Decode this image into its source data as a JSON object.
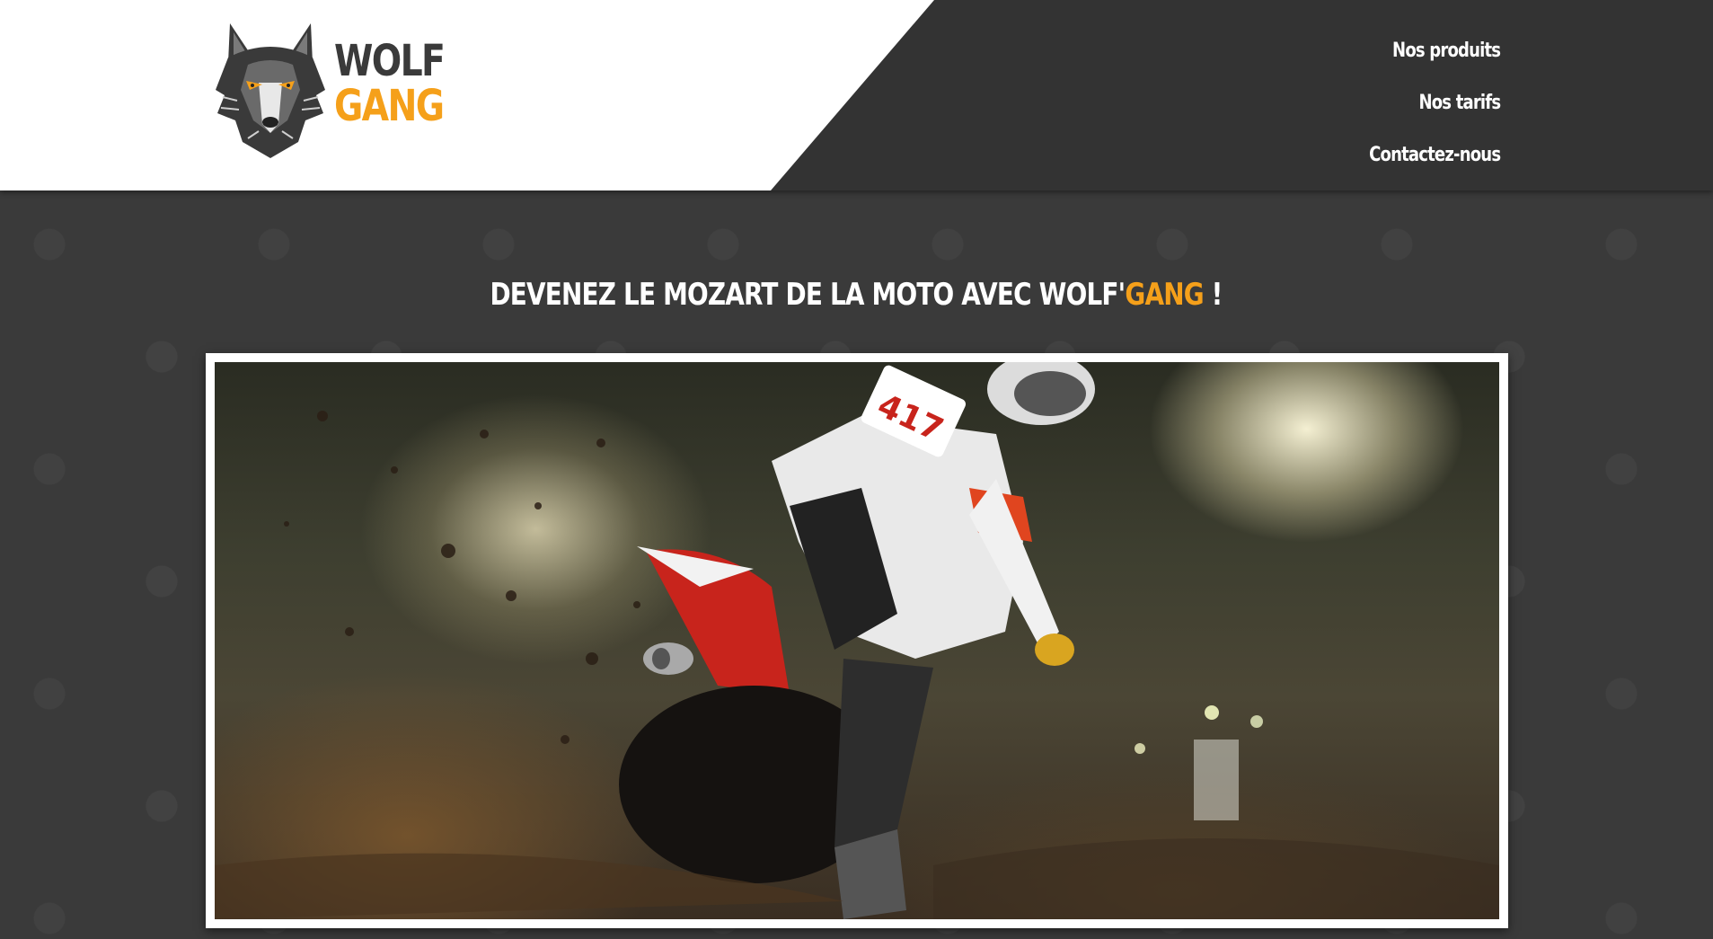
{
  "brand": {
    "line1": "WOLF",
    "line2": "GANG",
    "accent_color": "#f5a01a",
    "logo_icon": "wolf-head-icon"
  },
  "nav": {
    "items": [
      {
        "label": "Nos produits"
      },
      {
        "label": "Nos tarifs"
      },
      {
        "label": "Contactez-nous"
      }
    ]
  },
  "headline": {
    "prefix": "DEVENEZ LE MOZART DE LA MOTO AVEC WOLF'",
    "accent": "GANG",
    "suffix": " !"
  },
  "hero": {
    "image": "motocross-rider-photo",
    "rider_number": "417"
  },
  "colors": {
    "header_dark": "#333333",
    "page_bg": "#3a3a3a",
    "accent": "#f5a01a"
  }
}
